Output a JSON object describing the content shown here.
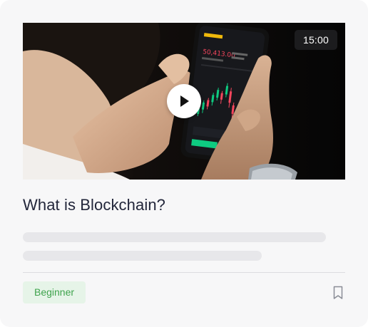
{
  "course": {
    "title": "What is Blockchain?",
    "duration": "15:00",
    "level": "Beginner"
  },
  "phone_screen": {
    "price": "50,413.00"
  },
  "icons": {
    "play": "play-icon",
    "bookmark": "bookmark-icon"
  },
  "colors": {
    "badge_text": "#3fa34d",
    "badge_bg": "#e6f4e8",
    "title": "#22263a"
  }
}
